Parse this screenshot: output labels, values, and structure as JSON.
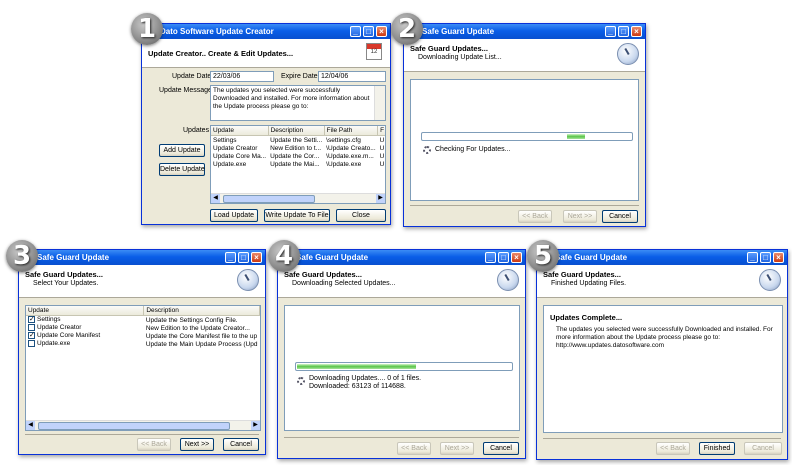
{
  "badges": [
    "1",
    "2",
    "3",
    "4",
    "5"
  ],
  "w1": {
    "title": "Dato Software Update Creator",
    "header": "Update Creator.. Create & Edit Updates...",
    "update_date_label": "Update Date",
    "update_date": "22/03/06",
    "expire_date_label": "Expire Date",
    "expire_date": "12/04/06",
    "message_label": "Update Message",
    "message": "The updates you selected were successfully Downloaded and installed. For more information about the Update process please go to:",
    "updates_label": "Updates",
    "columns": [
      "Update",
      "Description",
      "File Path",
      "F"
    ],
    "rows": [
      [
        "Settings",
        "Update the Setti...",
        "\\settings.cfg",
        "U"
      ],
      [
        "Update Creator",
        "New Edition to t...",
        "\\Update Creato...",
        "U"
      ],
      [
        "Update Core Ma...",
        "Update the Cor...",
        "\\Update.exe.m...",
        "U"
      ],
      [
        "Update.exe",
        "Update the Mai...",
        "\\Update.exe",
        "U"
      ]
    ],
    "add_label": "Add Update",
    "delete_label": "Delete Update",
    "load_label": "Load Update",
    "write_label": "Write Update To File",
    "close_label": "Close"
  },
  "w2": {
    "title": "Safe Guard Update",
    "header": "Safe Guard Updates...",
    "subheader": "Downloading Update List...",
    "status": "Checking For Updates...",
    "back_label": "<< Back",
    "next_label": "Next >>",
    "cancel_label": "Cancel"
  },
  "w3": {
    "title": "Safe Guard Update",
    "header": "Safe Guard Updates...",
    "subheader": "Select Your Updates.",
    "columns": [
      "Update",
      "Description"
    ],
    "rows": [
      {
        "name": "Settings",
        "desc": "Update the Settings Config File.",
        "checked": true
      },
      {
        "name": "Update Creator",
        "desc": "New Edition to the Update Creator...",
        "checked": false
      },
      {
        "name": "Update Core Manifest",
        "desc": "Update the Core Manifest file to the up",
        "checked": true
      },
      {
        "name": "Update.exe",
        "desc": "Update the Main Update Process (Upd",
        "checked": false
      }
    ],
    "back_label": "<< Back",
    "next_label": "Next >>",
    "cancel_label": "Cancel"
  },
  "w4": {
    "title": "Safe Guard Update",
    "header": "Safe Guard Updates...",
    "subheader": "Downloading Selected Updates...",
    "status1": "Downloading Updates.... 0 of 1 files.",
    "status2": "Downloaded: 63123 of 114688.",
    "progress": 0.55,
    "back_label": "<< Back",
    "next_label": "Next >>",
    "cancel_label": "Cancel"
  },
  "w5": {
    "title": "Safe Guard Update",
    "header": "Safe Guard Updates...",
    "subheader": "Finished Updating Files.",
    "complete_title": "Updates Complete...",
    "complete_msg": "The updates you selected were successfully Downloaded and installed. For more information about the Update process please go to: http://www.updates.datosoftware.com",
    "back_label": "<< Back",
    "finished_label": "Finished",
    "cancel_label": "Cancel"
  }
}
